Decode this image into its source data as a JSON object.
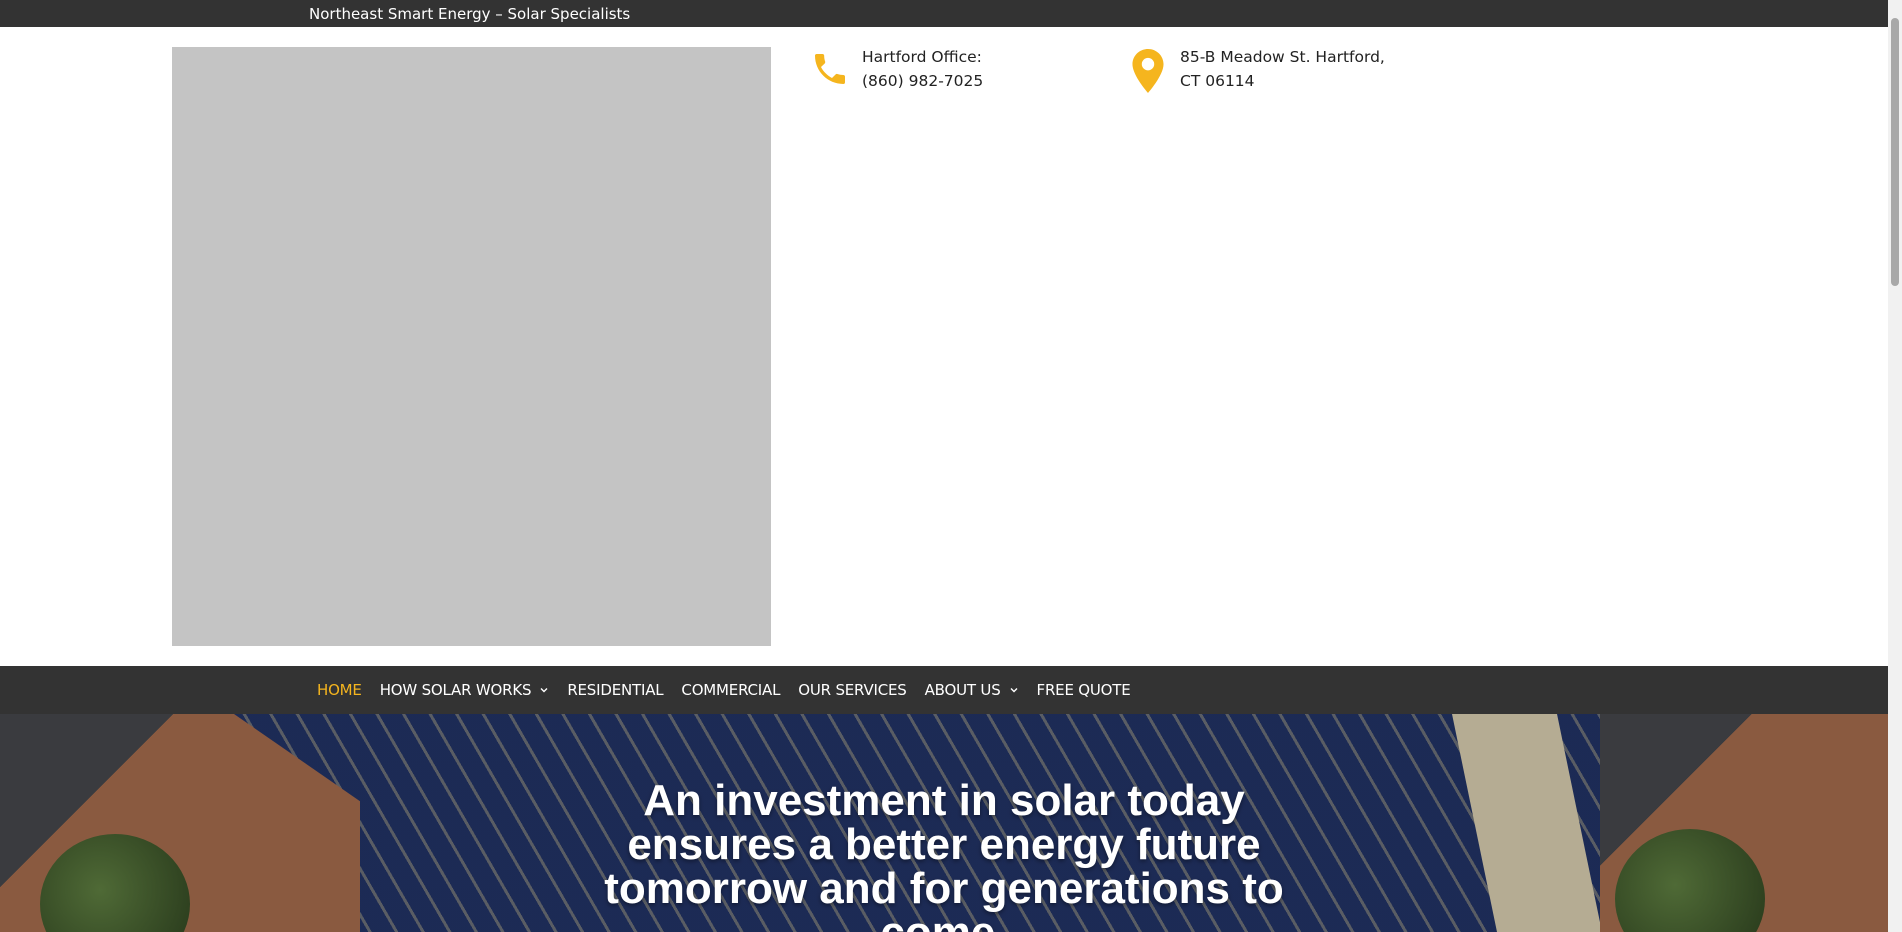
{
  "topbar": {
    "site_title": "Northeast Smart Energy – Solar Specialists"
  },
  "header": {
    "phone": {
      "label": "Hartford Office:",
      "number": "(860) 982-7025",
      "icon": "phone-icon"
    },
    "address": {
      "line": "85-B Meadow St. Hartford, CT 06114",
      "icon": "map-pin-icon"
    }
  },
  "nav": {
    "items": [
      {
        "label": "HOME",
        "active": true
      },
      {
        "label": "HOW SOLAR WORKS",
        "has_dropdown": true
      },
      {
        "label": "RESIDENTIAL"
      },
      {
        "label": "COMMERCIAL"
      },
      {
        "label": "OUR SERVICES"
      },
      {
        "label": "ABOUT US",
        "has_dropdown": true
      },
      {
        "label": "FREE QUOTE"
      }
    ]
  },
  "hero": {
    "headline": "An investment in solar today ensures a better energy future tomorrow and for generations to come."
  },
  "colors": {
    "accent": "#f5b51e",
    "bar": "#333333",
    "placeholder": "#c4c4c4"
  }
}
